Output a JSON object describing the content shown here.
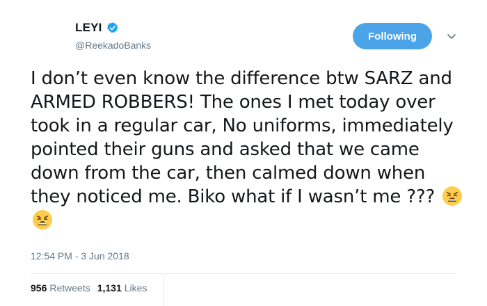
{
  "user": {
    "display_name": "LEYI",
    "handle": "@ReekadoBanks",
    "verified": true
  },
  "follow_button": {
    "label": "Following"
  },
  "tweet": {
    "text": "I don’t even know the difference btw SARZ and ARMED ROBBERS! The ones I met today over took in a regular car, No uniforms, immediately pointed their guns and asked that we came down from the car, then calmed down when  they noticed me. Biko what if I wasn’t me ???",
    "emojis": [
      "weary-face-emoji",
      "weary-face-emoji"
    ],
    "timestamp": "12:54 PM - 3 Jun 2018"
  },
  "stats": {
    "retweets_count": "956",
    "retweets_label": "Retweets",
    "likes_count": "1,131",
    "likes_label": "Likes"
  },
  "colors": {
    "accent": "#4ba3e8",
    "verified": "#1da1f2",
    "secondary_text": "#657786",
    "primary_text": "#14171a"
  }
}
